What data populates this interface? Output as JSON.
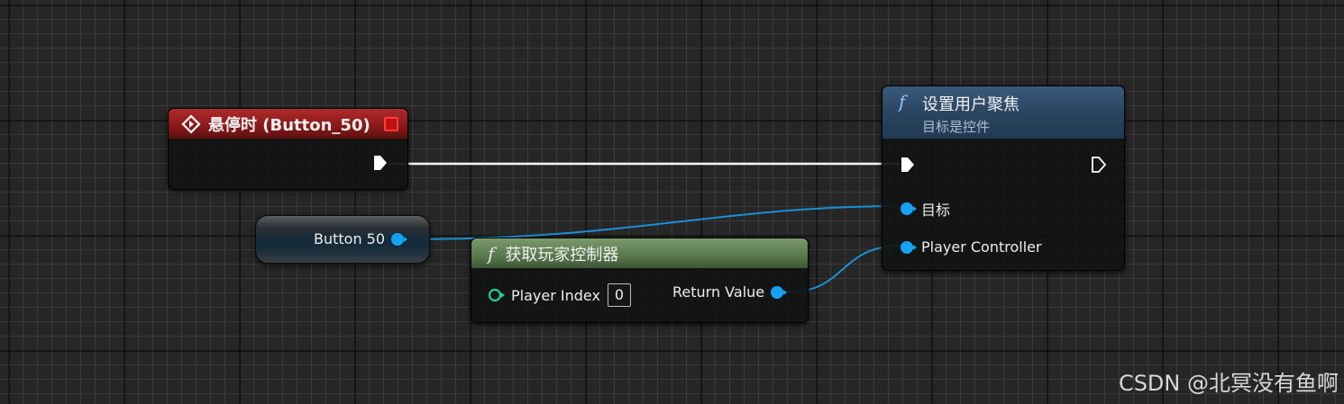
{
  "event_node": {
    "title": "悬停时 (Button_50)"
  },
  "variable_node": {
    "label": "Button 50"
  },
  "get_player_controller_node": {
    "title": "获取玩家控制器",
    "input_label": "Player Index",
    "input_value": "0",
    "output_label": "Return Value"
  },
  "set_user_focus_node": {
    "title": "设置用户聚焦",
    "subtitle": "目标是控件",
    "target_label": "目标",
    "player_controller_label": "Player Controller"
  },
  "watermark": "CSDN @北冥没有鱼啊",
  "colors": {
    "event_header": "#8b1c1c",
    "function_header_blue": "#2b4863",
    "function_header_green": "#5b7a4f",
    "object_pin": "#16a2f2",
    "int_pin": "#1fd1a0",
    "exec_wire": "#ffffff",
    "object_wire": "#1b8fd6"
  },
  "icons": {
    "event": "event-diamond-icon",
    "function": "function-f-icon",
    "stop": "stop-square-icon"
  }
}
